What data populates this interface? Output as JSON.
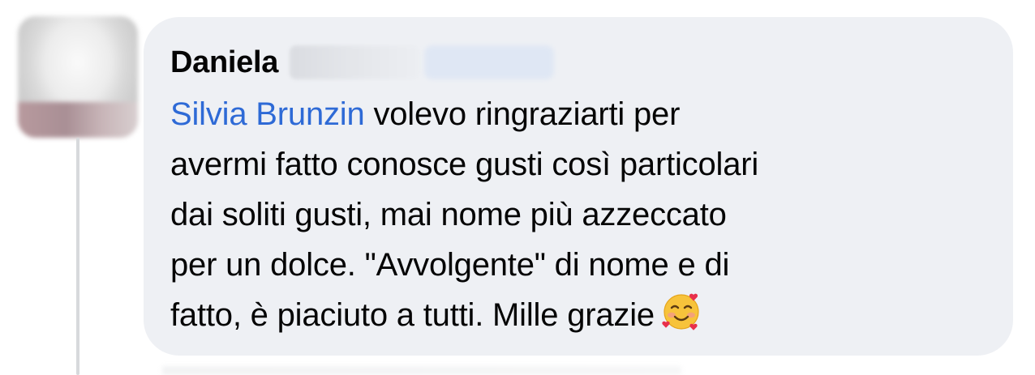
{
  "comment": {
    "author_first_name": "Daniela",
    "mention": "Silvia Brunzin",
    "text_lines": [
      " volevo ringraziarti per",
      "avermi fatto conosce gusti così particolari",
      "dai soliti gusti, mai nome più azzeccato",
      "per un dolce. \"Avvolgente\" di nome e di",
      "fatto, è piaciuto a tutti. Mille grazie"
    ],
    "emoji": "smiling-face-with-hearts"
  },
  "colors": {
    "bubble_bg": "#eef0f4",
    "mention": "#2e6ad6",
    "text": "#050505"
  }
}
